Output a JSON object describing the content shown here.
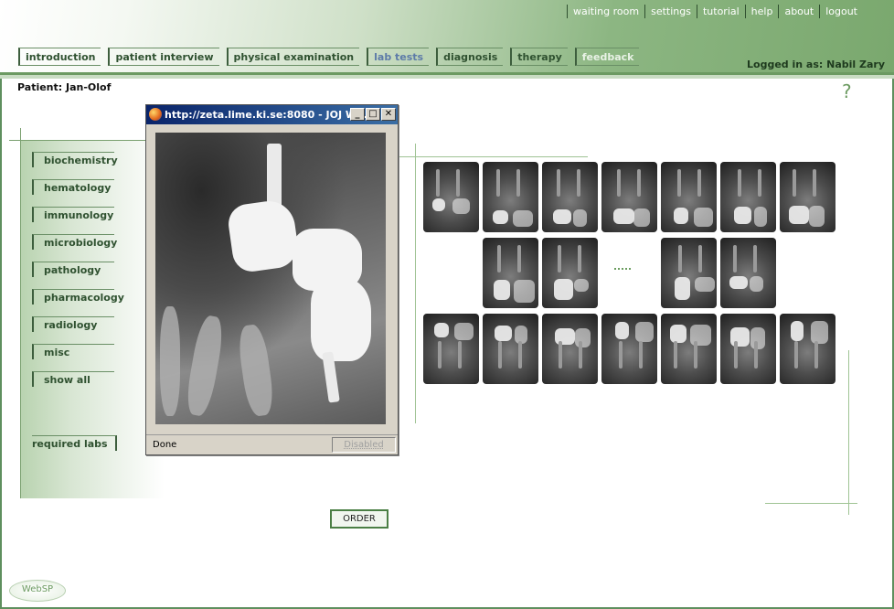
{
  "top_nav": [
    "waiting room",
    "settings",
    "tutorial",
    "help",
    "about",
    "logout"
  ],
  "tabs": [
    {
      "label": "introduction",
      "state": "normal"
    },
    {
      "label": "patient interview",
      "state": "normal"
    },
    {
      "label": "physical examination",
      "state": "normal"
    },
    {
      "label": "lab tests",
      "state": "active"
    },
    {
      "label": "diagnosis",
      "state": "normal"
    },
    {
      "label": "therapy",
      "state": "normal"
    },
    {
      "label": "feedback",
      "state": "dim"
    }
  ],
  "user": {
    "logged_in_as": "Logged in as: Nabil Zary"
  },
  "patient": {
    "label": "Patient: Jan-Olof"
  },
  "help_icon": "?",
  "sidebar": {
    "items": [
      "biochemistry",
      "hematology",
      "immunology",
      "microbiology",
      "pathology",
      "pharmacology",
      "radiology",
      "misc",
      "show all"
    ],
    "required": "required labs"
  },
  "order_button": "ORDER",
  "logo_text": "WebSP",
  "popup": {
    "title": "http://zeta.lime.ki.se:8080 - JOJ W...",
    "status_text": "Done",
    "status_right": "Disabled",
    "buttons": [
      "minimize",
      "maximize",
      "close"
    ]
  },
  "colors": {
    "brand_green": "#6c9a62",
    "active_tab": "#5d7ba8",
    "title_bar": "#0a246a"
  },
  "thumbnails": {
    "rows": [
      [
        "xray",
        "xray",
        "xray",
        "xray",
        "xray",
        "xray",
        "xray"
      ],
      [
        "none",
        "xray",
        "xray",
        "blank",
        "xray",
        "xray",
        "none"
      ],
      [
        "xray",
        "xray",
        "xray",
        "xray",
        "xray",
        "xray",
        "xray"
      ]
    ]
  }
}
